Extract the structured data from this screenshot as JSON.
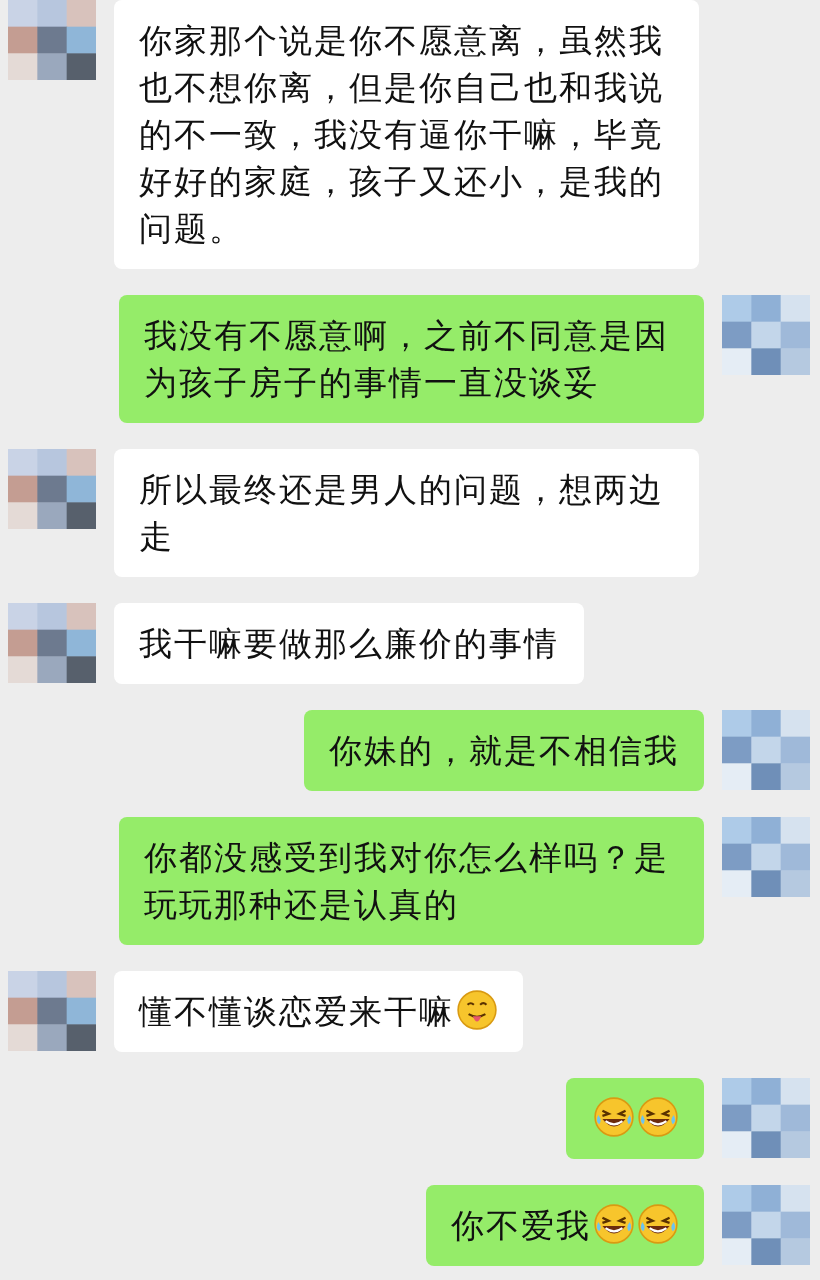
{
  "messages": [
    {
      "kind": "incoming",
      "parts": [
        {
          "kind": "text",
          "text": "你家那个说是你不愿意离，虽然我也不想你离，但是你自己也和我说的不一致，我没有逼你干嘛，毕竟好好的家庭，孩子又还小，是我的问题。"
        }
      ]
    },
    {
      "kind": "outgoing",
      "parts": [
        {
          "kind": "text",
          "text": "我没有不愿意啊，之前不同意是因为孩子房子的事情一直没谈妥"
        }
      ]
    },
    {
      "kind": "incoming",
      "parts": [
        {
          "kind": "text",
          "text": "所以最终还是男人的问题，想两边走"
        }
      ]
    },
    {
      "kind": "incoming",
      "parts": [
        {
          "kind": "text",
          "text": "我干嘛要做那么廉价的事情"
        }
      ]
    },
    {
      "kind": "outgoing",
      "parts": [
        {
          "kind": "text",
          "text": "你妹的，就是不相信我"
        }
      ]
    },
    {
      "kind": "outgoing",
      "parts": [
        {
          "kind": "text",
          "text": "你都没感受到我对你怎么样吗？是玩玩那种还是认真的"
        }
      ]
    },
    {
      "kind": "incoming",
      "parts": [
        {
          "kind": "text",
          "text": "懂不懂谈恋爱来干嘛"
        },
        {
          "kind": "tongue"
        }
      ]
    },
    {
      "kind": "outgoing",
      "parts": [
        {
          "kind": "laugh"
        },
        {
          "kind": "laugh"
        }
      ]
    },
    {
      "kind": "outgoing",
      "parts": [
        {
          "kind": "text",
          "text": "你不爱我"
        },
        {
          "kind": "laugh"
        },
        {
          "kind": "laugh"
        }
      ]
    }
  ]
}
